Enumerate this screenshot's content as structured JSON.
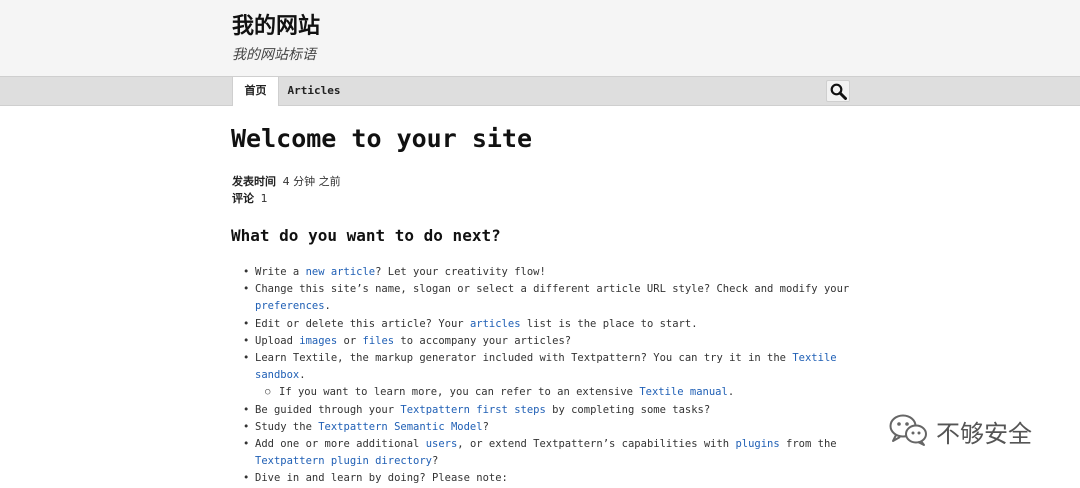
{
  "site": {
    "name": "我的网站",
    "slogan": "我的网站标语"
  },
  "nav": {
    "tabs": [
      {
        "label": "首页",
        "active": true
      },
      {
        "label": "Articles",
        "active": false
      }
    ]
  },
  "search": {
    "icon": "search-icon"
  },
  "article": {
    "title": "Welcome to your site",
    "posted_label": "发表时间",
    "posted_value": "4 分钟 之前",
    "comments_label": "评论",
    "comments_value": "1"
  },
  "section": {
    "heading": "What do you want to do next?"
  },
  "list": {
    "i1": {
      "a": "Write a ",
      "l1": "new article",
      "b": "? Let your creativity flow!"
    },
    "i2": {
      "a": "Change this site’s name, slogan or select a different article URL style? Check and modify your ",
      "l1": "preferences",
      "b": "."
    },
    "i3": {
      "a": "Edit or delete this article? Your ",
      "l1": "articles",
      "b": " list is the place to start."
    },
    "i4": {
      "a": "Upload ",
      "l1": "images",
      "b": " or ",
      "l2": "files",
      "c": " to accompany your articles?"
    },
    "i5": {
      "a": "Learn Textile, the markup generator included with Textpattern? You can try it in the ",
      "l1": "Textile sandbox",
      "b": "."
    },
    "i5s": {
      "a": "If you want to learn more, you can refer to an extensive ",
      "l1": "Textile manual",
      "b": "."
    },
    "i6": {
      "a": "Be guided through your ",
      "l1": "Textpattern first steps",
      "b": " by completing some tasks?"
    },
    "i7": {
      "a": "Study the ",
      "l1": "Textpattern Semantic Model",
      "b": "?"
    },
    "i8": {
      "a": "Add one or more additional ",
      "l1": "users",
      "b": ", or extend Textpattern’s capabilities with ",
      "l2": "plugins",
      "c": " from the ",
      "l3": "Textpattern plugin directory",
      "d": "?"
    },
    "i9": {
      "a": "Dive in and learn by doing? Please note:"
    }
  },
  "watermark": {
    "text": "不够安全",
    "icon": "wechat-icon"
  }
}
